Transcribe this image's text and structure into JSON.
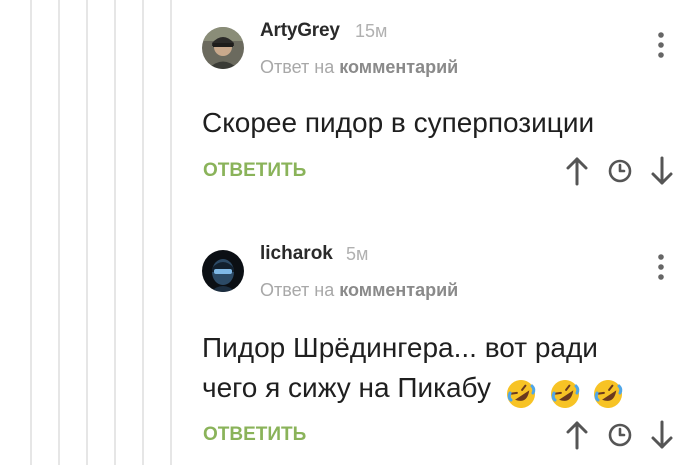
{
  "comments": [
    {
      "author": "ArtyGrey",
      "time": "15м",
      "reply_prefix": "Ответ на",
      "reply_link": "комментарий",
      "text": "Скорее пидор в суперпозиции",
      "reply_label": "ОТВЕТИТЬ"
    },
    {
      "author": "licharok",
      "time": "5м",
      "reply_prefix": "Ответ на",
      "reply_link": "комментарий",
      "text_line1": "Пидор Шрёдингера... вот ради",
      "text_line2": "чего я сижу на Пикабу",
      "emojis": [
        "rolling-on-floor-laughing",
        "rolling-on-floor-laughing",
        "rolling-on-floor-laughing"
      ],
      "reply_label": "ОТВЕТИТЬ"
    }
  ],
  "icons": {
    "more": "more-vertical-icon",
    "upvote": "arrow-up-icon",
    "save": "clock-icon",
    "downvote": "arrow-down-icon"
  },
  "colors": {
    "reply_green": "#8ab35a",
    "muted_text": "#a8a8a8",
    "thread_line": "#e6e6e6",
    "icon_gray": "#555555"
  }
}
